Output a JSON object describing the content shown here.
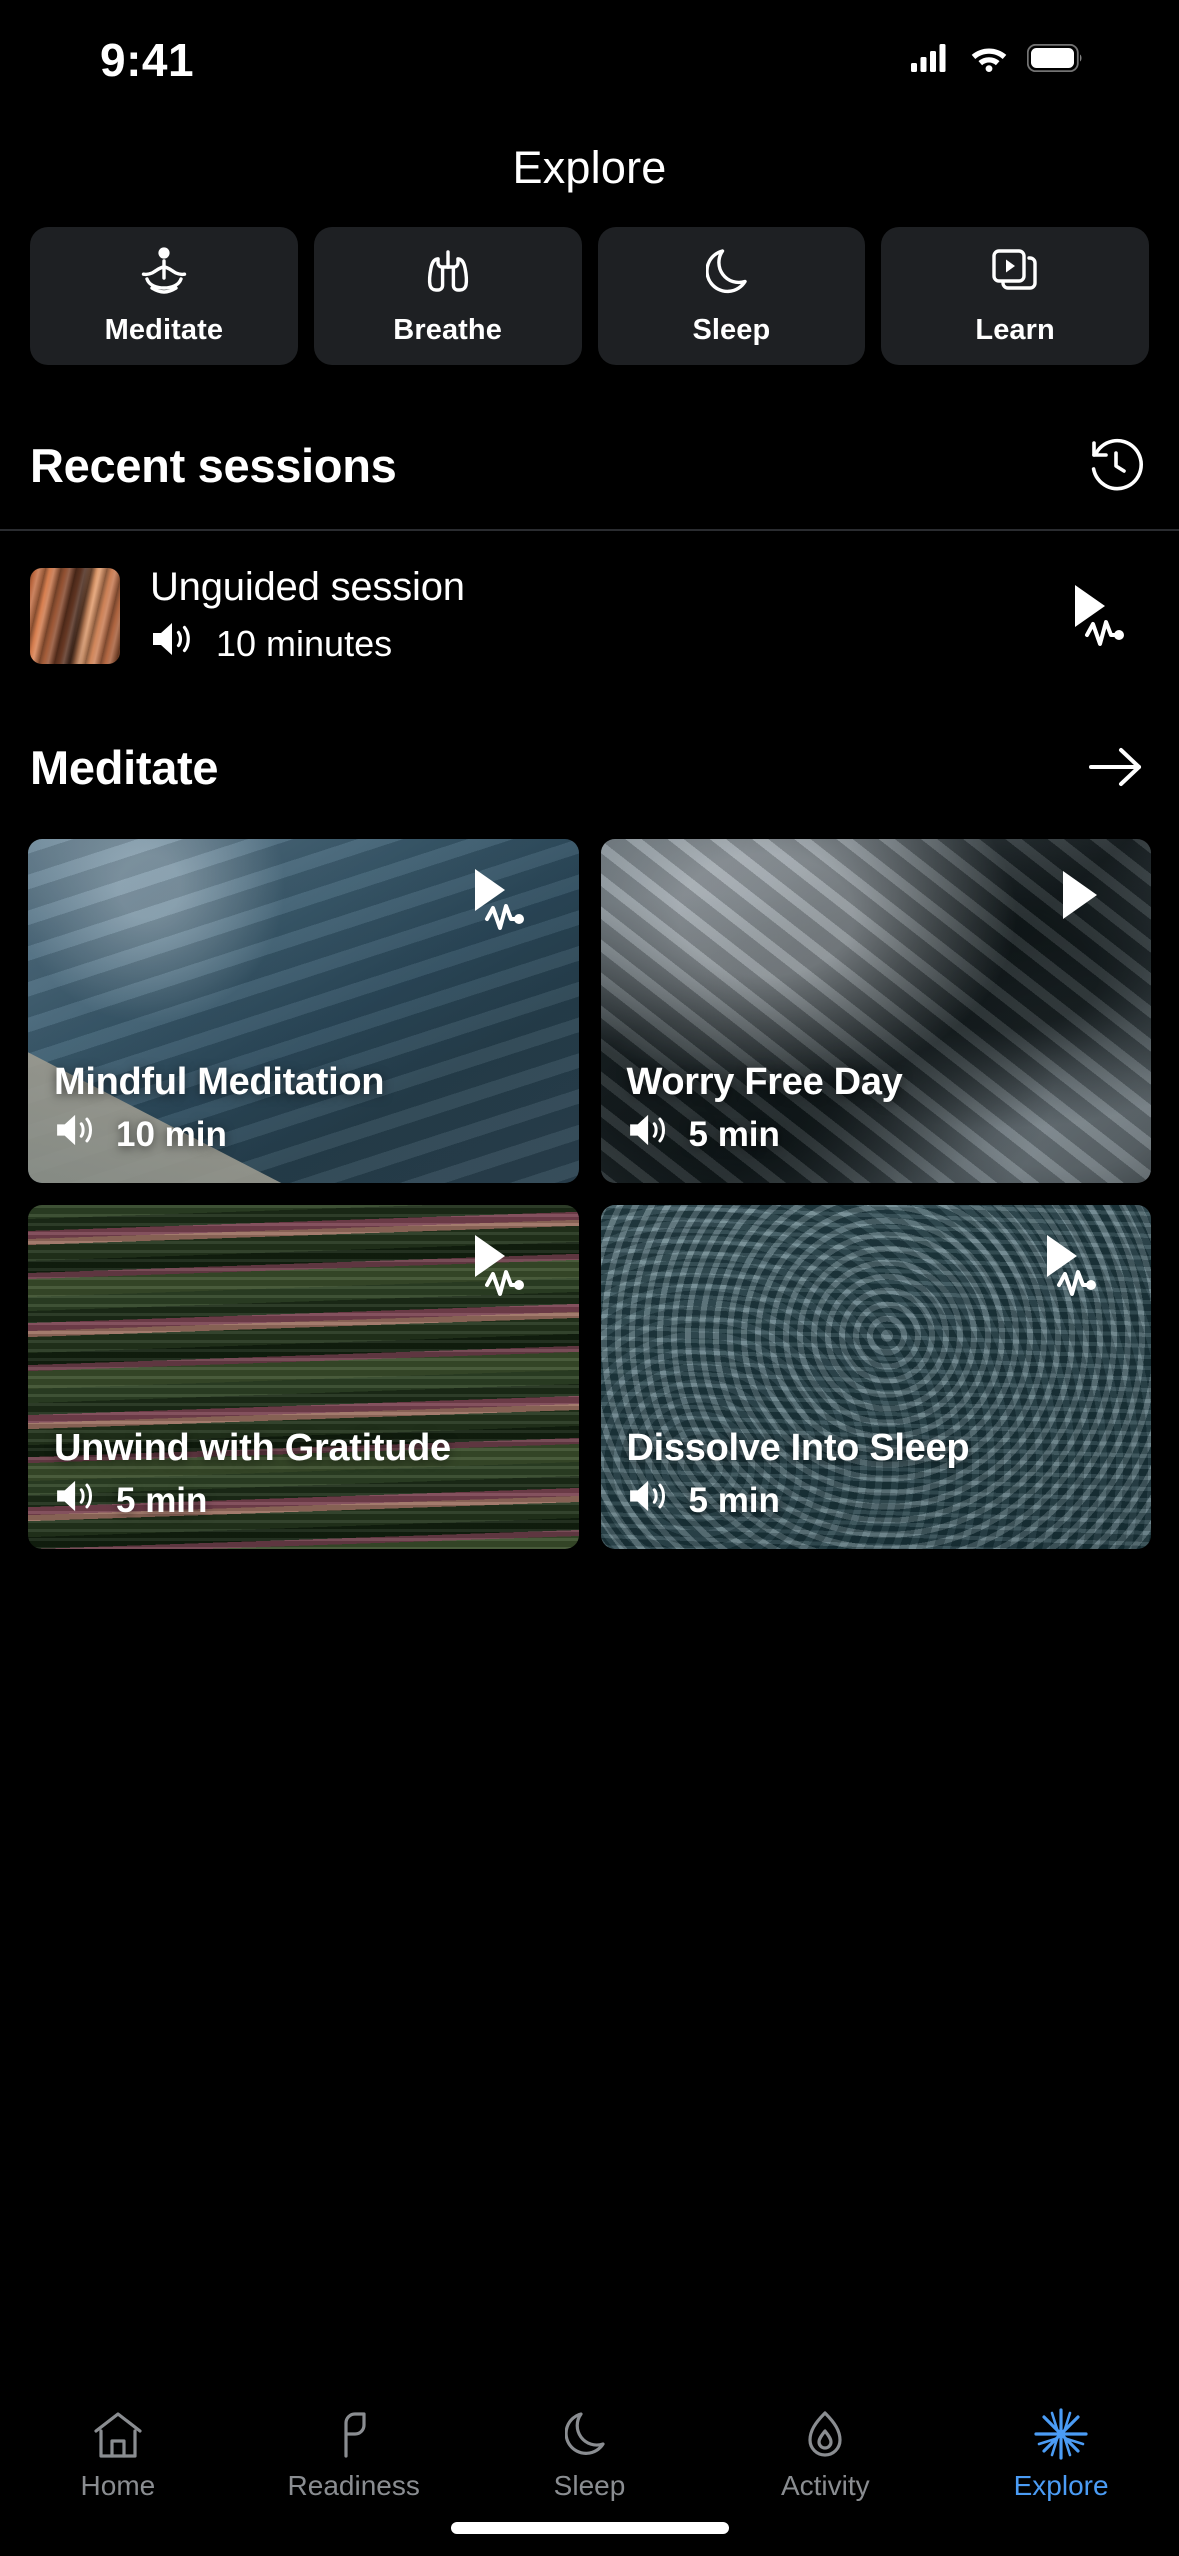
{
  "status_bar": {
    "time": "9:41",
    "cellular_icon": "cellular-signal-icon",
    "wifi_icon": "wifi-icon",
    "battery_icon": "battery-icon"
  },
  "header": {
    "title": "Explore"
  },
  "categories": [
    {
      "label": "Meditate",
      "icon": "meditation-lotus-icon"
    },
    {
      "label": "Breathe",
      "icon": "lungs-icon"
    },
    {
      "label": "Sleep",
      "icon": "crescent-moon-icon"
    },
    {
      "label": "Learn",
      "icon": "media-stack-play-icon"
    }
  ],
  "recent": {
    "title": "Recent sessions",
    "action_icon": "history-clock-icon",
    "session": {
      "title": "Unguided session",
      "duration": "10 minutes",
      "audio_icon": "speaker-waves-icon",
      "play_icon": "play-waveform-icon"
    }
  },
  "meditate_section": {
    "title": "Meditate",
    "action_icon": "arrow-right-icon",
    "cards": [
      {
        "title": "Mindful Meditation",
        "duration": "10 min",
        "art": "art-mindful",
        "audio_icon": "speaker-waves-icon",
        "play_icon": "play-waveform-icon"
      },
      {
        "title": "Worry Free Day",
        "duration": "5 min",
        "art": "art-worry",
        "audio_icon": "speaker-waves-icon",
        "play_icon": "play-icon"
      },
      {
        "title": "Unwind with Gratitude",
        "duration": "5 min",
        "art": "art-unwind",
        "audio_icon": "speaker-waves-icon",
        "play_icon": "play-waveform-icon"
      },
      {
        "title": "Dissolve Into Sleep",
        "duration": "5 min",
        "art": "art-dissolve",
        "audio_icon": "speaker-waves-icon",
        "play_icon": "play-waveform-icon"
      }
    ]
  },
  "bottom_nav": {
    "active_color": "#4b9cf5",
    "inactive_color": "#8a8d91",
    "items": [
      {
        "label": "Home",
        "icon": "home-icon",
        "active": false
      },
      {
        "label": "Readiness",
        "icon": "readiness-icon",
        "active": false
      },
      {
        "label": "Sleep",
        "icon": "moon-icon",
        "active": false
      },
      {
        "label": "Activity",
        "icon": "flame-icon",
        "active": false
      },
      {
        "label": "Explore",
        "icon": "starburst-icon",
        "active": true
      }
    ]
  }
}
